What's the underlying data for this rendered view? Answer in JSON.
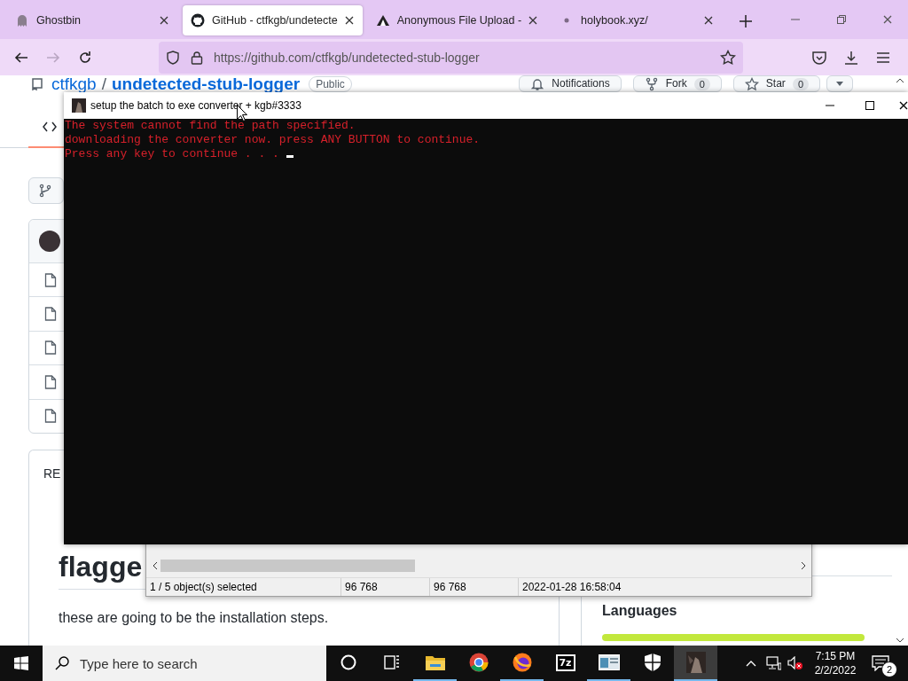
{
  "browser": {
    "tabs": [
      {
        "title": "Ghostbin",
        "selected": false
      },
      {
        "title": "GitHub - ctfkgb/undetecte",
        "selected": true
      },
      {
        "title": "Anonymous File Upload -",
        "selected": false
      },
      {
        "title": "holybook.xyz/",
        "selected": false
      }
    ],
    "nav_buttons": [
      {
        "disabled": false
      },
      {
        "disabled": true
      },
      {
        "disabled": false
      }
    ],
    "url": "https://github.com/ctfkgb/undetected-stub-logger"
  },
  "repo_page": {
    "owner": "ctfkgb",
    "separator": "/",
    "name": "undetected-stub-logger",
    "visibility": "Public",
    "actions": [
      {
        "label": "Notifications"
      },
      {
        "label": "Fork",
        "count": "0"
      },
      {
        "label": "Star",
        "count": "0"
      }
    ],
    "readme_tab": "RE",
    "heading_lines": [
      "flagge"
    ],
    "paragraph": "these are going to be the installation steps.",
    "languages_title": "Languages"
  },
  "console": {
    "title": "setup the batch to exe converter + kgb#3333",
    "lines": [
      "The system cannot find the path specified.",
      "downloading the converter now. press ANY BUTTON to continue.",
      "Press any key to continue . . ."
    ]
  },
  "file_manager": {
    "status": [
      "1 / 5 object(s) selected",
      "96 768",
      "96 768",
      "2022-01-28 16:58:04"
    ]
  },
  "taskbar": {
    "search": {
      "placeholder": "Type here to search"
    },
    "apps": [
      {
        "running": true,
        "selected": false
      },
      {
        "running": false,
        "selected": false
      },
      {
        "running": true,
        "selected": false
      },
      {
        "label": "7z",
        "running": false,
        "selected": false
      },
      {
        "running": true,
        "selected": false
      },
      {
        "running": false,
        "selected": false
      },
      {
        "running": true,
        "selected": true
      }
    ],
    "clock": {
      "time": "7:15 PM",
      "date": "2/2/2022"
    },
    "notification_count": "2"
  }
}
